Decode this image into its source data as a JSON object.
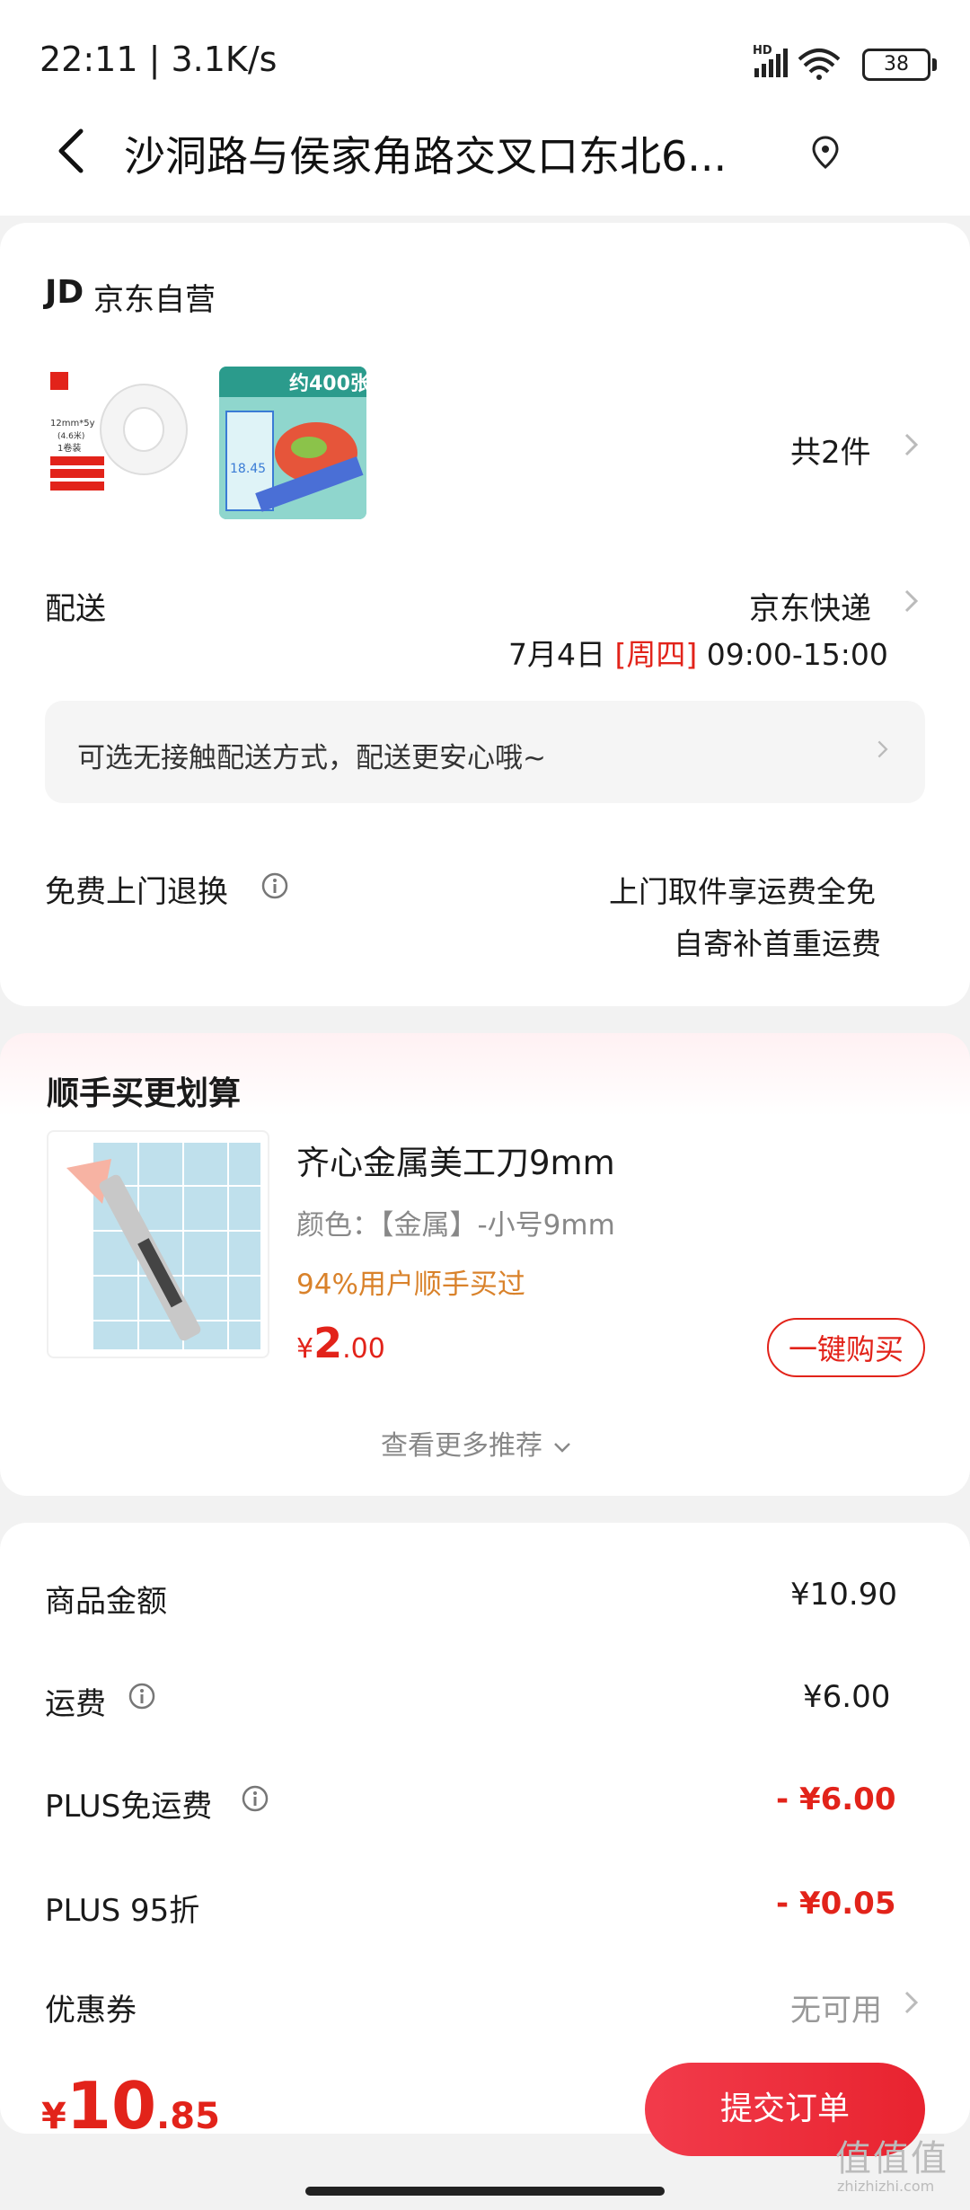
{
  "status_bar": {
    "time": "22:11 | 3.1K/s",
    "network_label": "HD",
    "battery": "38"
  },
  "header": {
    "address": "沙洞路与侯家角路交叉口东北6..."
  },
  "shop": {
    "logo": "JD",
    "name": "京东自营",
    "products_count": "共2件",
    "product1": {
      "label": "12mm*5y",
      "sub": "(4.6米)",
      "pack": "1卷装"
    },
    "product2": {
      "banner": "约400张",
      "price_tag": "18.45"
    }
  },
  "delivery": {
    "label": "配送",
    "carrier": "京东快递",
    "date": "7月4日",
    "weekday": "[周四]",
    "time_window": "09:00-15:00",
    "contactless_tip": "可选无接触配送方式，配送更安心哦~"
  },
  "returns": {
    "label": "免费上门退换",
    "line1": "上门取件享运费全免",
    "line2": "自寄补首重运费"
  },
  "addon": {
    "title": "顺手买更划算",
    "product_name": "齐心金属美工刀9mm",
    "spec": "颜色：【金属】-小号9mm",
    "promo": "94%用户顺手买过",
    "currency": "¥",
    "price_int": "2",
    "price_dec": ".00",
    "buy_button": "一键购买",
    "more": "查看更多推荐"
  },
  "summary": {
    "rows": [
      {
        "label": "商品金额",
        "value": "¥10.90",
        "info": false,
        "red": false
      },
      {
        "label": "运费",
        "value": "¥6.00",
        "info": true,
        "red": false
      },
      {
        "label": "PLUS免运费",
        "value": "- ¥6.00",
        "info": true,
        "red": true
      },
      {
        "label": "PLUS 95折",
        "value": "- ¥0.05",
        "info": false,
        "red": true
      }
    ],
    "coupon_label": "优惠券",
    "coupon_value": "无可用"
  },
  "footer": {
    "currency": "¥",
    "total_int": "10",
    "total_dec": ".85",
    "submit_label": "提交订单"
  },
  "watermark": {
    "text": "值值值",
    "url": "zhizhizhi.com"
  },
  "colors": {
    "accent_red": "#e2231a",
    "promo_orange": "#d9822b"
  }
}
